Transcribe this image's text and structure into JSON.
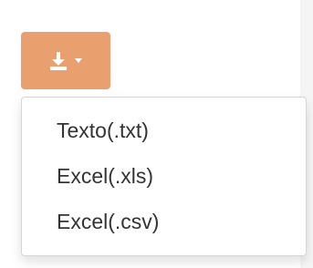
{
  "toolbar": {
    "download_button": {
      "icon": "download-icon",
      "caret_icon": "caret-down-icon",
      "background": "#e9a06f"
    }
  },
  "menu": {
    "items": [
      {
        "label": "Texto(.txt)"
      },
      {
        "label": "Excel(.xls)"
      },
      {
        "label": "Excel(.csv)"
      }
    ]
  }
}
